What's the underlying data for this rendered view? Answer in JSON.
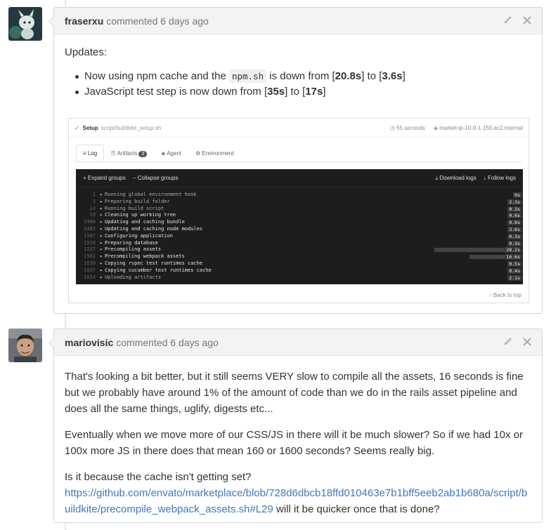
{
  "comments": [
    {
      "author": "fraserxu",
      "meta": "commented 6 days ago",
      "body": {
        "intro": "Updates:",
        "bullets": [
          {
            "a": "Now using npm cache and the ",
            "code": "npm.sh",
            "b": " is down from [",
            "v1": "20.8s",
            "c": "] to [",
            "v2": "3.6s",
            "d": "]"
          },
          {
            "a": "JavaScript test step is now down from [",
            "v1": "35s",
            "c": "] to [",
            "v2": "17s",
            "d": "]"
          }
        ]
      }
    },
    {
      "author": "mariovisic",
      "meta": "commented 6 days ago",
      "paragraphs": [
        "That's looking a bit better, but it still seems VERY slow to compile all the assets, 16 seconds is fine but we probably have around 1% of the amount of code than we do in the rails asset pipeline and does all the same things, uglify, digests etc...",
        "Eventually when we move more of our CSS/JS in there will it be much slower? So if we had 10x or 100x more JS in there does that mean 160 or 1600 seconds? Seems really big."
      ],
      "last_para": {
        "pre": "Is it because the cache isn't getting set?",
        "link": "https://github.com/envato/marketplace/blob/728d6dbcb18ffd010463e7b1bff5eeb2ab1b680a/script/buildkite/precompile_webpack_assets.sh#L29",
        "post": " will it be quicker once that is done?"
      }
    }
  ],
  "buildkite": {
    "step": "Setup",
    "script": "script/buildkite_setup.sh",
    "duration": "55 seconds",
    "agent_host": "market-ip-10-0-1-150.ec2.internal",
    "tabs": [
      "Log",
      "Artifacts",
      "Agent",
      "Environment"
    ],
    "artifacts_count": "3",
    "expand": "Expand groups",
    "collapse": "Collapse groups",
    "download": "Download logs",
    "follow": "Follow logs",
    "back_to_top": "Back to top",
    "log_rows": [
      {
        "line": "1",
        "text": "Running global environment hook",
        "time": "0s",
        "dim": true,
        "frac": 0
      },
      {
        "line": "3",
        "text": "Preparing build folder",
        "time": "2.3s",
        "dim": true,
        "frac": 0
      },
      {
        "line": "13",
        "text": "Running build script",
        "time": "0.3s",
        "dim": true,
        "frac": 0
      },
      {
        "line": "19",
        "text": "Cleaning up working tree",
        "time": "0.6s",
        "dim": false,
        "frac": 0
      },
      {
        "line": "1468",
        "text": "Updating and caching bundle",
        "time": "0.6s",
        "dim": false,
        "frac": 0
      },
      {
        "line": "1482",
        "text": "Updating and caching node modules",
        "time": "3.6s",
        "dim": false,
        "frac": 0
      },
      {
        "line": "1507",
        "text": "Configuring application",
        "time": "0.3s",
        "dim": false,
        "frac": 0
      },
      {
        "line": "1518",
        "text": "Preparing database",
        "time": "0.3s",
        "dim": false,
        "frac": 0
      },
      {
        "line": "1537",
        "text": "Precompiling assets",
        "time": "28.2s",
        "dim": false,
        "frac": 1.0
      },
      {
        "line": "1581",
        "text": "Precompiling webpack assets",
        "time": "16.6s",
        "dim": false,
        "frac": 0.5
      },
      {
        "line": "1639",
        "text": "Copying rspec test runtimes cache",
        "time": "0.5s",
        "dim": false,
        "frac": 0
      },
      {
        "line": "1647",
        "text": "Copying cucumber test runtimes cache",
        "time": "0.4s",
        "dim": false,
        "frac": 0
      },
      {
        "line": "1654",
        "text": "Uploading artifacts",
        "time": "2.1s",
        "dim": true,
        "frac": 0
      }
    ]
  }
}
